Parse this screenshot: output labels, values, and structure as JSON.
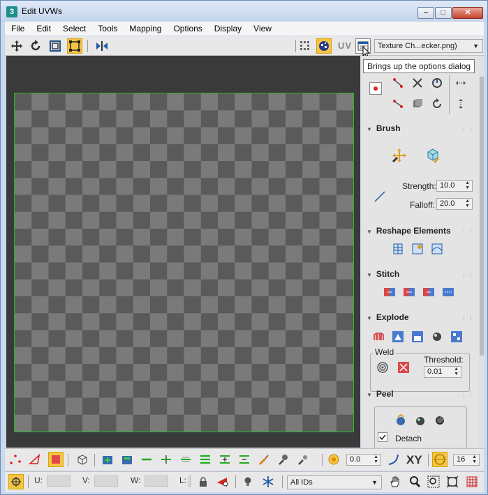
{
  "window": {
    "title": "Edit UVWs",
    "app_icon_text": "3"
  },
  "menu": [
    "File",
    "Edit",
    "Select",
    "Tools",
    "Mapping",
    "Options",
    "Display",
    "View"
  ],
  "toolbar": {
    "uv_label": "UV",
    "texture_dropdown": "Texture Ch...ecker.png)",
    "options_tooltip": "Brings up the options dialog"
  },
  "panel": {
    "brush": {
      "title": "Brush",
      "strength_label": "Strength:",
      "strength_value": "10.0",
      "falloff_label": "Falloff:",
      "falloff_value": "20.0"
    },
    "reshape": {
      "title": "Reshape Elements"
    },
    "stitch": {
      "title": "Stitch"
    },
    "explode": {
      "title": "Explode",
      "weld_label": "Weld",
      "threshold_label": "Threshold:",
      "threshold_value": "0.01"
    },
    "peel": {
      "title": "Peel",
      "detach_label": "Detach"
    }
  },
  "bottom_bar": {
    "spin_value": "0.0",
    "xy_label": "XY",
    "grid_value": "16"
  },
  "status_bar": {
    "u_label": "U:",
    "v_label": "V:",
    "w_label": "W:",
    "l_label": "L:",
    "ids_dropdown": "All IDs"
  },
  "colors": {
    "active_button": "#f5c542",
    "checker_light": "#7a7a7a",
    "checker_dark": "#5a5a5a",
    "uv_border": "#1ec01e",
    "viewport_bg": "#3a3a3a"
  }
}
